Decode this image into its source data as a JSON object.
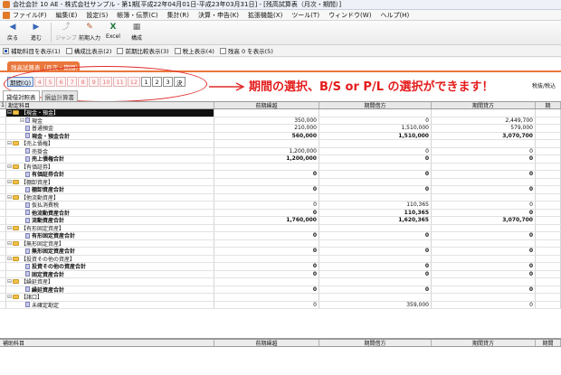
{
  "window_title": "会社会計 10 AE - 株式会社サンプル - 第1期[平成22年04月01日-平成23年03月31日] - [残高試算表（月次・期間）]",
  "menu": [
    "ファイル(F)",
    "編集(E)",
    "設定(S)",
    "帳簿・伝票(C)",
    "集計(R)",
    "決算・申告(K)",
    "拡張機能(X)",
    "ツール(T)",
    "ウィンドウ(W)",
    "ヘルプ(H)"
  ],
  "toolbar": {
    "back": "戻る",
    "forward": "進む",
    "jump": "ジャンプ",
    "prev_input": "前期入力",
    "excel": "Excel",
    "layout": "構成"
  },
  "options": [
    {
      "label": "補助科目を表示(1)",
      "checked": true
    },
    {
      "label": "構成比表示(2)",
      "checked": false
    },
    {
      "label": "前期比較表示(3)",
      "checked": false
    },
    {
      "label": "税上表示(4)",
      "checked": false
    },
    {
      "label": "残高 0 を表示(5)",
      "checked": false
    }
  ],
  "panel_title": "残高試算表（月次・期間）",
  "period_bar": {
    "selected": "期間(Q)",
    "months": [
      "4",
      "5",
      "6",
      "7",
      "8",
      "9",
      "10",
      "11",
      "12"
    ],
    "quarters": [
      "1",
      "2",
      "3"
    ],
    "settle": "決"
  },
  "annotation": "期間の選択、B/S or P/L の選択ができます！",
  "right_note": "税抜/税込",
  "tabs": {
    "bs": "貸借対照表",
    "pl": "損益計算書"
  },
  "columns": [
    "勘定科目",
    "前期繰越",
    "期間借方",
    "期間貸方",
    "期"
  ],
  "rows": [
    {
      "indent": 0,
      "type": "group",
      "expander": "⊟",
      "label": "【現金・預金】",
      "v": [
        "",
        "",
        ""
      ],
      "selected": true
    },
    {
      "indent": 1,
      "type": "item",
      "expander": "⊟",
      "label": "現金",
      "v": [
        "350,000",
        "0",
        "2,449,700"
      ]
    },
    {
      "indent": 1,
      "type": "item",
      "expander": "",
      "label": "普通預金",
      "v": [
        "210,000",
        "1,510,000",
        "579,000"
      ]
    },
    {
      "indent": 1,
      "type": "total",
      "expander": "",
      "label": "現金・預金合計",
      "v": [
        "560,000",
        "1,510,000",
        "3,070,700"
      ]
    },
    {
      "indent": 0,
      "type": "group",
      "expander": "⊟",
      "label": "【売上債権】",
      "v": [
        "",
        "",
        ""
      ]
    },
    {
      "indent": 1,
      "type": "item",
      "expander": "",
      "label": "売掛金",
      "v": [
        "1,200,000",
        "0",
        "0"
      ]
    },
    {
      "indent": 1,
      "type": "total",
      "expander": "",
      "label": "売上債権合計",
      "v": [
        "1,200,000",
        "0",
        "0"
      ]
    },
    {
      "indent": 0,
      "type": "group",
      "expander": "⊟",
      "label": "【有価証券】",
      "v": [
        "",
        "",
        ""
      ]
    },
    {
      "indent": 1,
      "type": "total",
      "expander": "",
      "label": "有価証券合計",
      "v": [
        "0",
        "0",
        "0"
      ]
    },
    {
      "indent": 0,
      "type": "group",
      "expander": "⊟",
      "label": "【棚卸資産】",
      "v": [
        "",
        "",
        ""
      ]
    },
    {
      "indent": 1,
      "type": "total",
      "expander": "",
      "label": "棚卸資産合計",
      "v": [
        "0",
        "0",
        "0"
      ]
    },
    {
      "indent": 0,
      "type": "group",
      "expander": "⊟",
      "label": "【他流動資産】",
      "v": [
        "",
        "",
        ""
      ]
    },
    {
      "indent": 1,
      "type": "item",
      "expander": "",
      "label": "仮払消費税",
      "v": [
        "0",
        "110,365",
        "0"
      ]
    },
    {
      "indent": 1,
      "type": "total",
      "expander": "",
      "label": "他流動資産合計",
      "v": [
        "0",
        "110,365",
        "0"
      ]
    },
    {
      "indent": 1,
      "type": "total",
      "expander": "",
      "label": "流動資産合計",
      "v": [
        "1,760,000",
        "1,620,365",
        "3,070,700"
      ]
    },
    {
      "indent": 0,
      "type": "group",
      "expander": "⊟",
      "label": "【有形固定資産】",
      "v": [
        "",
        "",
        ""
      ]
    },
    {
      "indent": 1,
      "type": "total",
      "expander": "",
      "label": "有形固定資産合計",
      "v": [
        "0",
        "0",
        "0"
      ]
    },
    {
      "indent": 0,
      "type": "group",
      "expander": "⊟",
      "label": "【無形固定資産】",
      "v": [
        "",
        "",
        ""
      ]
    },
    {
      "indent": 1,
      "type": "total",
      "expander": "",
      "label": "無形固定資産合計",
      "v": [
        "0",
        "0",
        "0"
      ]
    },
    {
      "indent": 0,
      "type": "group",
      "expander": "⊟",
      "label": "【投資その他の資産】",
      "v": [
        "",
        "",
        ""
      ]
    },
    {
      "indent": 1,
      "type": "total",
      "expander": "",
      "label": "投資その他の資産合計",
      "v": [
        "0",
        "0",
        "0"
      ]
    },
    {
      "indent": 1,
      "type": "total",
      "expander": "",
      "label": "固定資産合計",
      "v": [
        "0",
        "0",
        "0"
      ]
    },
    {
      "indent": 0,
      "type": "group",
      "expander": "⊟",
      "label": "【繰延資産】",
      "v": [
        "",
        "",
        ""
      ]
    },
    {
      "indent": 1,
      "type": "total",
      "expander": "",
      "label": "繰延資産合計",
      "v": [
        "0",
        "0",
        "0"
      ]
    },
    {
      "indent": 0,
      "type": "group",
      "expander": "⊟",
      "label": "【諸口】",
      "v": [
        "",
        "",
        ""
      ]
    },
    {
      "indent": 1,
      "type": "item",
      "expander": "",
      "label": "未確定勘定",
      "v": [
        "0",
        "359,000",
        "0"
      ]
    }
  ],
  "bottom_columns": [
    "補助科目",
    "前期繰越",
    "期間借方",
    "期間貸方",
    "期間"
  ]
}
